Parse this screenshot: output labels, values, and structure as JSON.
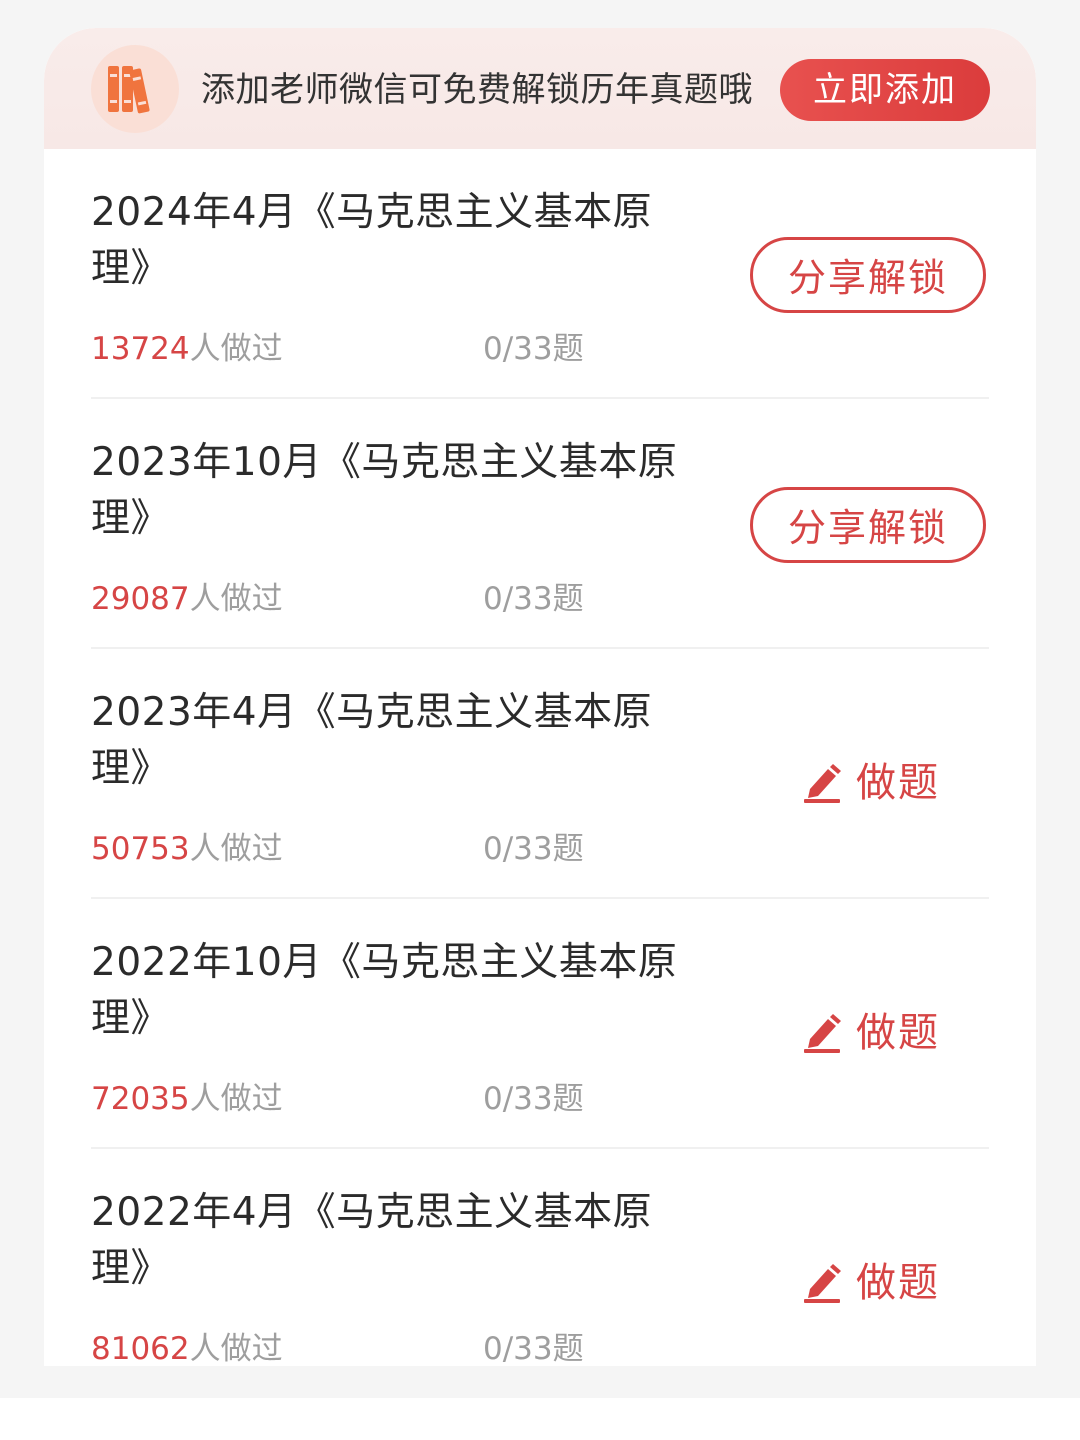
{
  "banner": {
    "icon": "books-icon",
    "text": "添加老师微信可免费解锁历年真题哦",
    "button_label": "立即添加"
  },
  "colors": {
    "accent": "#d64545",
    "banner_bg": "#f9ecea",
    "muted_text": "#9e9e9e"
  },
  "exams": [
    {
      "title": "2024年4月《马克思主义基本原理》",
      "count": "13724",
      "count_suffix": "人做过",
      "progress": "0/33题",
      "action": "share",
      "action_label": "分享解锁"
    },
    {
      "title": "2023年10月《马克思主义基本原理》",
      "count": "29087",
      "count_suffix": "人做过",
      "progress": "0/33题",
      "action": "share",
      "action_label": "分享解锁"
    },
    {
      "title": "2023年4月《马克思主义基本原理》",
      "count": "50753",
      "count_suffix": "人做过",
      "progress": "0/33题",
      "action": "do",
      "action_label": "做题",
      "action_icon": "pencil-icon"
    },
    {
      "title": "2022年10月《马克思主义基本原理》",
      "count": "72035",
      "count_suffix": "人做过",
      "progress": "0/33题",
      "action": "do",
      "action_label": "做题",
      "action_icon": "pencil-icon"
    },
    {
      "title": "2022年4月《马克思主义基本原理》",
      "count": "81062",
      "count_suffix": "人做过",
      "progress": "0/33题",
      "action": "do",
      "action_label": "做题",
      "action_icon": "pencil-icon"
    }
  ]
}
